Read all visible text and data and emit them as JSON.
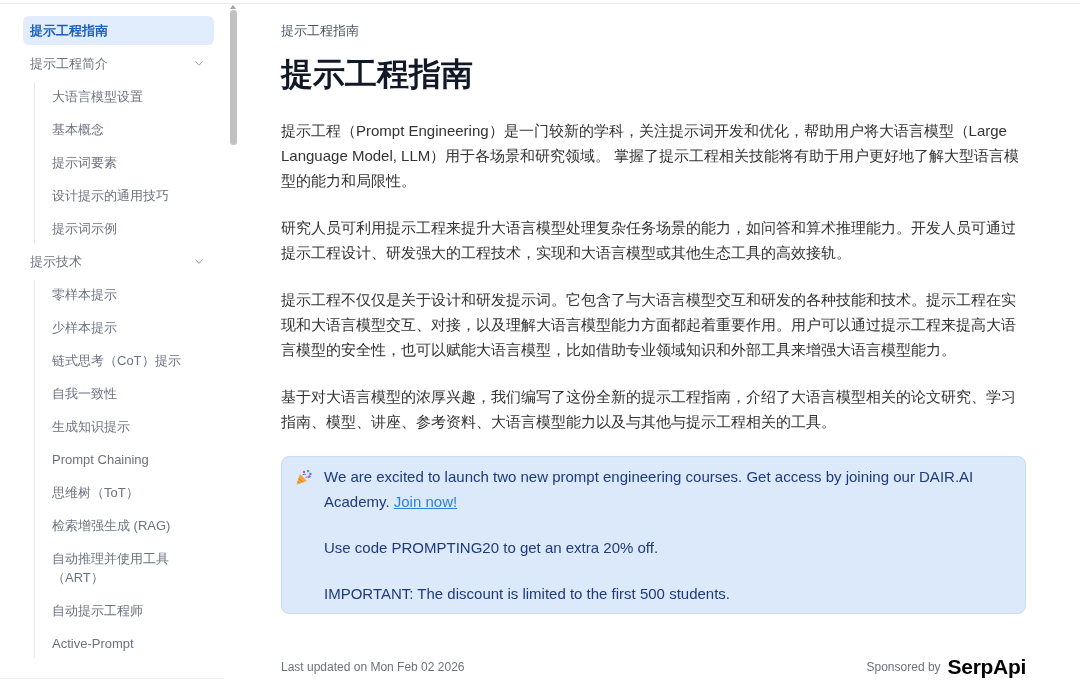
{
  "sidebar": {
    "items": [
      {
        "kind": "page",
        "label": "提示工程指南",
        "selected": true
      },
      {
        "kind": "section",
        "label": "提示工程简介",
        "selected": false,
        "expanded": true,
        "children": [
          {
            "label": "大语言模型设置",
            "selected": false
          },
          {
            "label": "基本概念",
            "selected": false
          },
          {
            "label": "提示词要素",
            "selected": false
          },
          {
            "label": "设计提示的通用技巧",
            "selected": false
          },
          {
            "label": "提示词示例",
            "selected": false
          }
        ]
      },
      {
        "kind": "section",
        "label": "提示技术",
        "selected": false,
        "expanded": true,
        "children": [
          {
            "label": "零样本提示",
            "selected": false
          },
          {
            "label": "少样本提示",
            "selected": false
          },
          {
            "label": "链式思考（CoT）提示",
            "selected": false
          },
          {
            "label": "自我一致性",
            "selected": false
          },
          {
            "label": "生成知识提示",
            "selected": false
          },
          {
            "label": "Prompt Chaining",
            "selected": false
          },
          {
            "label": "思维树（ToT）",
            "selected": false
          },
          {
            "label": "检索增强生成 (RAG)",
            "selected": false
          },
          {
            "label": "自动推理并使用工具（ART）",
            "selected": false
          },
          {
            "label": "自动提示工程师",
            "selected": false
          },
          {
            "label": "Active-Prompt",
            "selected": false
          }
        ]
      }
    ]
  },
  "page": {
    "breadcrumb": "提示工程指南",
    "title": "提示工程指南",
    "paragraphs": [
      "提示工程（Prompt Engineering）是一门较新的学科，关注提示词开发和优化，帮助用户将大语言模型（Large Language Model, LLM）用于各场景和研究领域。 掌握了提示工程相关技能将有助于用户更好地了解大型语言模型的能力和局限性。",
      "研究人员可利用提示工程来提升大语言模型处理复杂任务场景的能力，如问答和算术推理能力。开发人员可通过提示工程设计、研发强大的工程技术，实现和大语言模型或其他生态工具的高效接轨。",
      "提示工程不仅仅是关于设计和研发提示词。它包含了与大语言模型交互和研发的各种技能和技术。提示工程在实现和大语言模型交互、对接，以及理解大语言模型能力方面都起着重要作用。用户可以通过提示工程来提高大语言模型的安全性，也可以赋能大语言模型，比如借助专业领域知识和外部工具来增强大语言模型能力。",
      "基于对大语言模型的浓厚兴趣，我们编写了这份全新的提示工程指南，介绍了大语言模型相关的论文研究、学习指南、模型、讲座、参考资料、大语言模型能力以及与其他与提示工程相关的工具。"
    ]
  },
  "callout": {
    "paragraphs": [
      {
        "text": "We are excited to launch two new prompt engineering courses. Get access by joining our DAIR.AI Academy.",
        "link": "Join now!"
      },
      {
        "text": "Use code PROMPTING20 to get an extra 20% off."
      },
      {
        "text": "IMPORTANT: The discount is limited to the first 500 students."
      }
    ]
  },
  "footer": {
    "last_updated": "Last updated on Mon Feb 02 2026",
    "sponsor_label": "Sponsored by",
    "sponsor_logo": "SerpApi"
  }
}
